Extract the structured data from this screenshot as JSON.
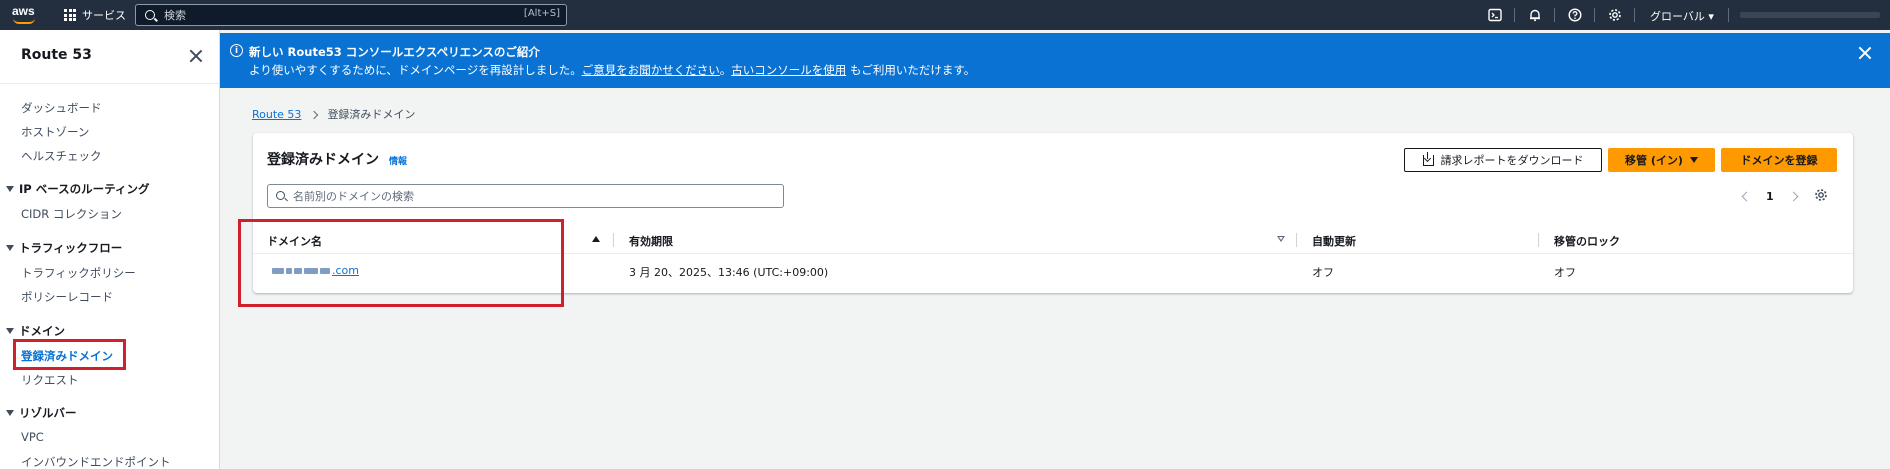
{
  "topnav": {
    "logo_text": "aws",
    "services_label": "サービス",
    "search_placeholder": "検索",
    "search_shortcut": "[Alt+S]",
    "region_label": "グローバル ▾",
    "icons": [
      "cloudshell-icon",
      "bell-icon",
      "help-icon",
      "gear-icon"
    ]
  },
  "sidebar": {
    "title": "Route 53",
    "items": [
      {
        "label": "ダッシュボード"
      },
      {
        "label": "ホストゾーン"
      },
      {
        "label": "ヘルスチェック"
      }
    ],
    "groups": [
      {
        "label": "IP ベースのルーティング",
        "items": [
          "CIDR コレクション"
        ]
      },
      {
        "label": "トラフィックフロー",
        "items": [
          "トラフィックポリシー",
          "ポリシーレコード"
        ]
      },
      {
        "label": "ドメイン",
        "items": [
          "登録済みドメイン",
          "リクエスト"
        ]
      },
      {
        "label": "リゾルバー",
        "items": [
          "VPC",
          "インバウンドエンドポイント"
        ]
      }
    ],
    "active_item": "登録済みドメイン"
  },
  "flash": {
    "title": "新しい Route53 コンソールエクスペリエンスのご紹介",
    "body_prefix": "より使いやすくするために、ドメインページを再設計しました。",
    "feedback_link": "ご意見をお聞かせください",
    "body_mid": "。",
    "old_console_link": "古いコンソールを使用",
    "body_suffix": "もご利用いただけます。"
  },
  "breadcrumb": {
    "root": "Route 53",
    "current": "登録済みドメイン"
  },
  "card": {
    "title": "登録済みドメイン",
    "info_label": "情報",
    "report_button": "請求レポートをダウンロード",
    "transfer_button": "移管 (イン)",
    "register_button": "ドメインを登録",
    "filter_placeholder": "名前別のドメインの検索",
    "page_number": "1"
  },
  "table": {
    "columns": [
      "ドメイン名",
      "有効期限",
      "自動更新",
      "移管のロック"
    ],
    "rows": [
      {
        "domain_suffix": ".com",
        "expiry": "3 月 20、2025、13:46 (UTC:+09:00)",
        "auto_renew": "オフ",
        "transfer_lock": "オフ"
      }
    ]
  },
  "colors": {
    "nav_bg": "#232f3e",
    "brand_orange": "#ff9900",
    "flash_blue": "#0972d3",
    "highlight_red": "#d0202e"
  }
}
